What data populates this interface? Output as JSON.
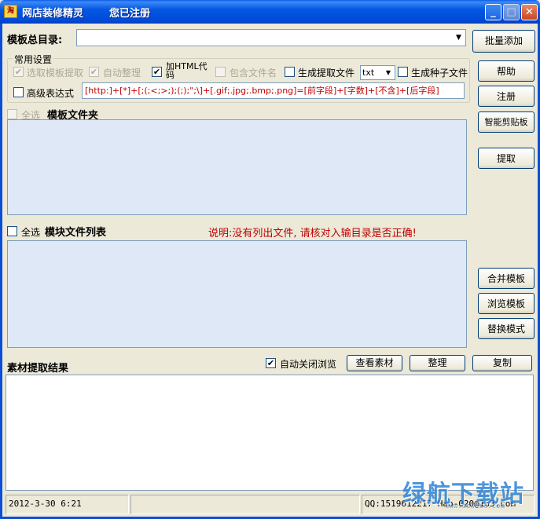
{
  "window": {
    "icon_text": "淘",
    "title": "网店装修精灵",
    "status_title": "您已注册",
    "min_glyph": "_",
    "max_glyph": "□",
    "close_glyph": "✕"
  },
  "template_dir": {
    "label": "模板总目录:",
    "value": ""
  },
  "common_settings": {
    "legend": "常用设置",
    "options": [
      {
        "label": "选取模板提取",
        "checked": true,
        "disabled": true
      },
      {
        "label": "自动整理",
        "checked": true,
        "disabled": true
      },
      {
        "label": "加HTML代码",
        "checked": true,
        "disabled": false
      },
      {
        "label": "包含文件名",
        "checked": false,
        "disabled": true
      },
      {
        "label": "生成提取文件",
        "checked": false,
        "disabled": false
      },
      {
        "label": "生成种子文件",
        "checked": false,
        "disabled": false
      }
    ],
    "file_type": "txt",
    "advanced": {
      "label": "高级表达式",
      "checked": false
    },
    "expression": "[http:]+[*]+[;(;<;>;);(;);\";\\]+[.gif;.jpg;.bmp;.png]=[前字段]+[字数]+[不含]+[后字段]"
  },
  "template_folder": {
    "select_all": "全选",
    "title": "模板文件夹"
  },
  "module_list": {
    "select_all": "全选",
    "title": "模块文件列表",
    "note": "说明:没有列出文件, 请核对入输目录是否正确!"
  },
  "right_buttons": {
    "batch_add": "批量添加",
    "help": "帮助",
    "register": "注册",
    "clipboard": "智能剪贴板",
    "extract": "提取",
    "merge": "合并模板",
    "browse": "浏览模板",
    "replace": "替换模式"
  },
  "result": {
    "title": "素材提取结果",
    "auto_close": {
      "label": "自动关闭浏览",
      "checked": true
    },
    "view": "查看素材",
    "organize": "整理",
    "copy": "复制"
  },
  "status_bar": {
    "datetime": "2012-3-30    6:21",
    "middle": "",
    "contact": "QQ:1519612217  Hao-020@163.com",
    "watermark": "绿航下载站",
    "watermark_url": "www.downcc.com"
  },
  "colors": {
    "title_blue": "#0458e3",
    "panel_bg": "#dfe8f7",
    "note_red": "#c00000",
    "face": "#ece9d8"
  }
}
